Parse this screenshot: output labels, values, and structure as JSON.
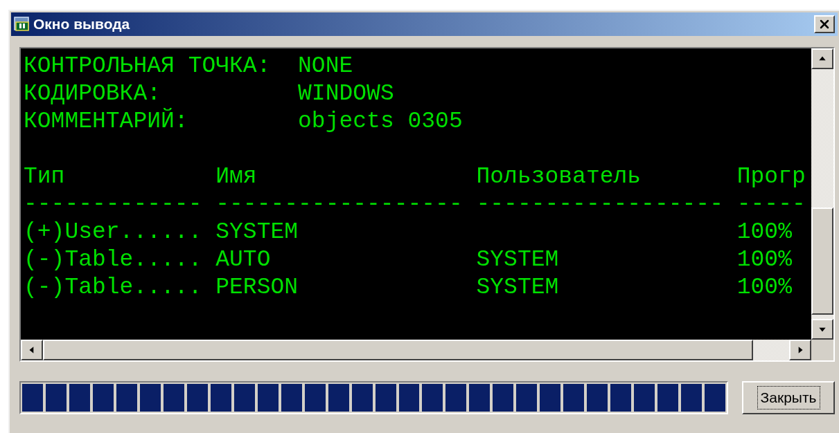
{
  "window": {
    "title": "Окно вывода"
  },
  "console": {
    "fields": [
      {
        "label": "КОНТРОЛЬНАЯ ТОЧКА:",
        "value": "NONE"
      },
      {
        "label": "КОДИРОВКА:",
        "value": "WINDOWS"
      },
      {
        "label": "КОММЕНТАРИЙ:",
        "value": "objects 0305"
      }
    ],
    "columns": [
      {
        "header": "Тип",
        "rule": "-------------"
      },
      {
        "header": "Имя",
        "rule": "------------------"
      },
      {
        "header": "Пользователь",
        "rule": "------------------"
      },
      {
        "header": "Прогр",
        "rule": "-----"
      }
    ],
    "rows": [
      [
        "(+)User......",
        "SYSTEM",
        "",
        "100%"
      ],
      [
        "(-)Table.....",
        "AUTO",
        "SYSTEM",
        "100%"
      ],
      [
        "(-)Table.....",
        "PERSON",
        "SYSTEM",
        "100%"
      ]
    ]
  },
  "progress": {
    "level": 1
  },
  "close_button": {
    "label": "Закрыть",
    "focused": true
  }
}
